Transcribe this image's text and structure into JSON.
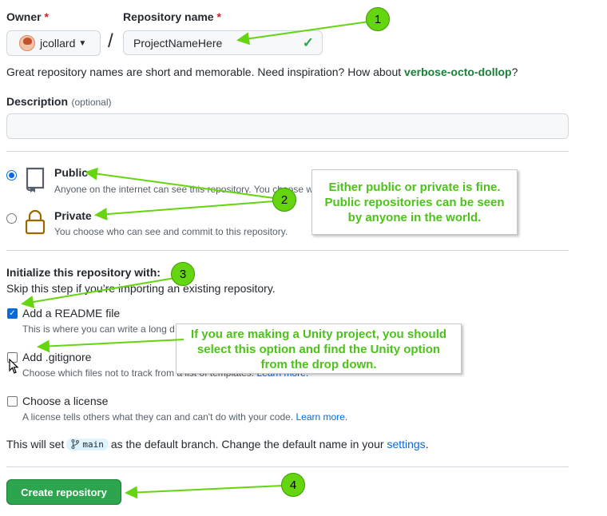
{
  "owner": {
    "label": "Owner",
    "required_mark": "*",
    "value": "jcollard"
  },
  "repo": {
    "label": "Repository name",
    "required_mark": "*",
    "value": "ProjectNameHere"
  },
  "hint": {
    "text": "Great repository names are short and memorable. Need inspiration? How about ",
    "suggestion": "verbose-octo-dollop",
    "end": "?"
  },
  "description": {
    "label": "Description",
    "optional": "(optional)",
    "value": ""
  },
  "visibility": {
    "public": {
      "title": "Public",
      "sub": "Anyone on the internet can see this repository. You choose w"
    },
    "private": {
      "title": "Private",
      "sub": "You choose who can see and commit to this repository."
    }
  },
  "init": {
    "heading": "Initialize this repository with:",
    "sub": "Skip this step if you’re importing an existing repository.",
    "readme": {
      "label": "Add a README file",
      "sub": "This is where you can write a long d"
    },
    "gitignore": {
      "label": "Add .gitignore",
      "sub": "Choose which files not to track from a list of templates.",
      "link": "Learn more."
    },
    "license": {
      "label": "Choose a license",
      "sub": "A license tells others what they can and can't do with your code.",
      "link": "Learn more."
    }
  },
  "branch_note": {
    "before": "This will set",
    "branch": "main",
    "after": "as the default branch. Change the default name in your",
    "link": "settings",
    "end": "."
  },
  "create_button": "Create repository",
  "callouts": {
    "visibility": "Either public or private is fine. Public repositories can be seen by anyone in the world.",
    "unity": "If you are making a Unity project, you should select this option and find the Unity option from the drop down."
  },
  "markers": [
    "1",
    "2",
    "3",
    "4"
  ],
  "colors": {
    "accent": "#0969da",
    "success": "#2da44e",
    "annotation": "#64d50f"
  }
}
